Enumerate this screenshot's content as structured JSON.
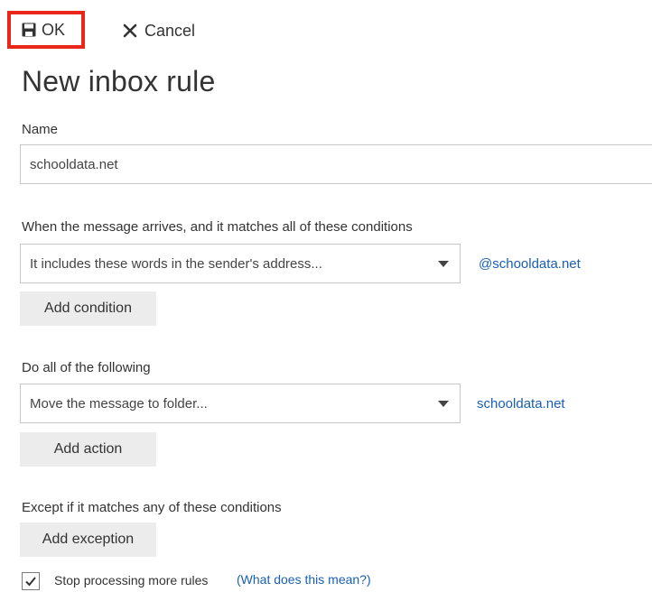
{
  "toolbar": {
    "ok_label": "OK",
    "cancel_label": "Cancel"
  },
  "page_title": "New inbox rule",
  "name_section": {
    "label": "Name",
    "value": "schooldata.net"
  },
  "conditions_section": {
    "label": "When the message arrives, and it matches all of these conditions",
    "selected": "It includes these words in the sender's address...",
    "value_link": "@schooldata.net",
    "add_button": "Add condition"
  },
  "actions_section": {
    "label": "Do all of the following",
    "selected": "Move the message to folder...",
    "value_link": "schooldata.net",
    "add_button": "Add action"
  },
  "exceptions_section": {
    "label": "Except if it matches any of these conditions",
    "add_button": "Add exception"
  },
  "stop_processing": {
    "checked": true,
    "label": "Stop processing more rules",
    "help_link": "(What does this mean?)"
  },
  "colors": {
    "highlight_border": "#e8261a",
    "link": "#1a5fb4",
    "button_bg": "#ececec"
  },
  "icons": {
    "ok": "save-icon",
    "cancel": "close-icon",
    "dropdown": "chevron-down-icon",
    "checkbox": "checkmark-icon"
  }
}
